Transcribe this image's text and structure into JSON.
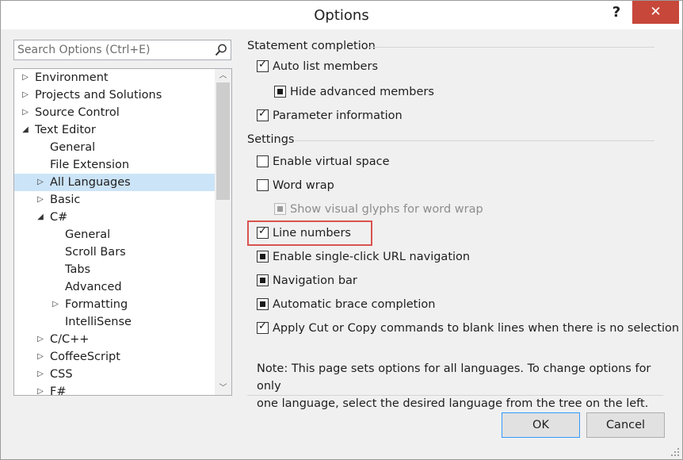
{
  "window": {
    "title": "Options",
    "help_label": "?",
    "close_label": "✕"
  },
  "search": {
    "placeholder": "Search Options (Ctrl+E)"
  },
  "tree": {
    "items": [
      {
        "label": "Environment",
        "expander": "▷"
      },
      {
        "label": "Projects and Solutions",
        "expander": "▷"
      },
      {
        "label": "Source Control",
        "expander": "▷"
      },
      {
        "label": "Text Editor",
        "expander": "◢"
      },
      {
        "label": "General",
        "expander": ""
      },
      {
        "label": "File Extension",
        "expander": ""
      },
      {
        "label": "All Languages",
        "expander": "▷",
        "selected": true
      },
      {
        "label": "Basic",
        "expander": "▷"
      },
      {
        "label": "C#",
        "expander": "◢"
      },
      {
        "label": "General",
        "expander": ""
      },
      {
        "label": "Scroll Bars",
        "expander": ""
      },
      {
        "label": "Tabs",
        "expander": ""
      },
      {
        "label": "Advanced",
        "expander": ""
      },
      {
        "label": "Formatting",
        "expander": "▷"
      },
      {
        "label": "IntelliSense",
        "expander": ""
      },
      {
        "label": "C/C++",
        "expander": "▷"
      },
      {
        "label": "CoffeeScript",
        "expander": "▷"
      },
      {
        "label": "CSS",
        "expander": "▷"
      },
      {
        "label": "F#",
        "expander": "▷"
      }
    ]
  },
  "statement_completion": {
    "header": "Statement completion",
    "auto_list_members": {
      "label": "Auto list members",
      "state": "checked"
    },
    "hide_advanced_members": {
      "label": "Hide advanced members",
      "state": "indeterminate"
    },
    "parameter_information": {
      "label": "Parameter information",
      "state": "checked"
    }
  },
  "settings": {
    "header": "Settings",
    "enable_virtual_space": {
      "label": "Enable virtual space",
      "state": "unchecked"
    },
    "word_wrap": {
      "label": "Word wrap",
      "state": "unchecked"
    },
    "show_visual_glyphs": {
      "label": "Show visual glyphs for word wrap",
      "state": "indeterminate",
      "disabled": true
    },
    "line_numbers": {
      "label": "Line numbers",
      "state": "checked"
    },
    "single_click_url": {
      "label": "Enable single-click URL navigation",
      "state": "indeterminate"
    },
    "navigation_bar": {
      "label": "Navigation bar",
      "state": "indeterminate"
    },
    "automatic_brace": {
      "label": "Automatic brace completion",
      "state": "indeterminate"
    },
    "apply_cut_copy": {
      "label": "Apply Cut or Copy commands to blank lines when there is no selection",
      "state": "checked"
    }
  },
  "note": {
    "line1": "Note: This page sets options for all languages. To change options for only",
    "line2": "one language, select the desired language from the tree on the left."
  },
  "buttons": {
    "ok": "OK",
    "cancel": "Cancel"
  },
  "colors": {
    "selection": "#cce4f7",
    "close_button": "#c7473a",
    "highlight_box": "#d9534f",
    "default_button_border": "#3399ff"
  }
}
